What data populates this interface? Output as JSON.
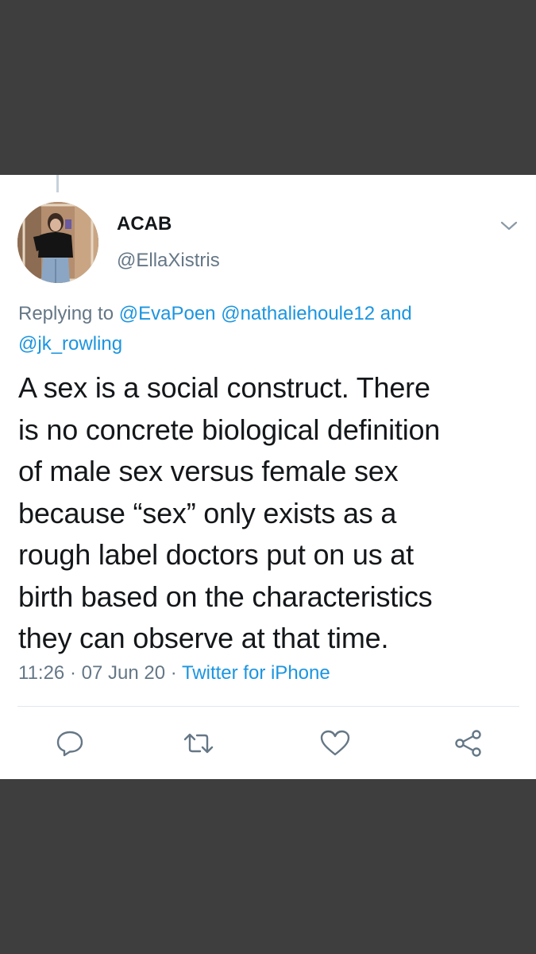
{
  "tweet": {
    "display_name": "ACAB",
    "handle": "@EllaXistris",
    "replying_prefix": "Replying to",
    "mentions": [
      "@EvaPoen",
      "@nathaliehoule12",
      "@jk_rowling"
    ],
    "mentions_joiner": "and",
    "text_lines": [
      "A sex is a social construct. There",
      "is no concrete biological definition",
      "of male sex versus female sex",
      "because “sex” only exists as a",
      "rough label doctors put on us at",
      "birth based on the characteristics",
      "they can observe at that time."
    ],
    "time": "11:26",
    "date": "07 Jun 20",
    "separator": "·",
    "source": "Twitter for iPhone"
  },
  "icons": {
    "more": "chevron-down-icon",
    "reply": "reply-icon",
    "retweet": "retweet-icon",
    "like": "heart-icon",
    "share": "share-icon"
  },
  "colors": {
    "background": "#3e3e3e",
    "card": "#ffffff",
    "text": "#14171a",
    "secondary": "#657786",
    "link": "#1b95e0"
  }
}
